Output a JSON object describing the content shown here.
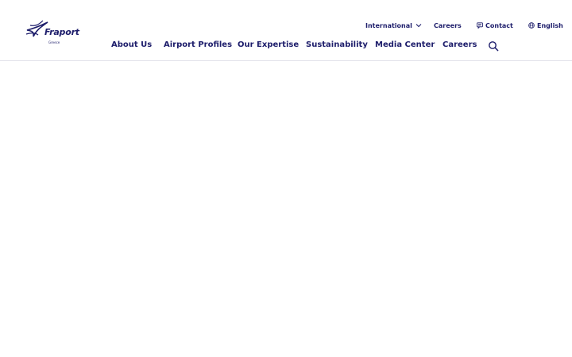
{
  "brand": {
    "name": "Fraport",
    "sub": "Greece",
    "color": "#1d1d6b"
  },
  "utility_nav": {
    "international": "International",
    "careers": "Careers",
    "contact": "Contact",
    "language": "English"
  },
  "main_nav": {
    "items": [
      "About Us",
      "Airport Profiles",
      "Our Expertise",
      "Sustainability",
      "Media Center",
      "Careers"
    ],
    "search_icon": "search-icon"
  }
}
